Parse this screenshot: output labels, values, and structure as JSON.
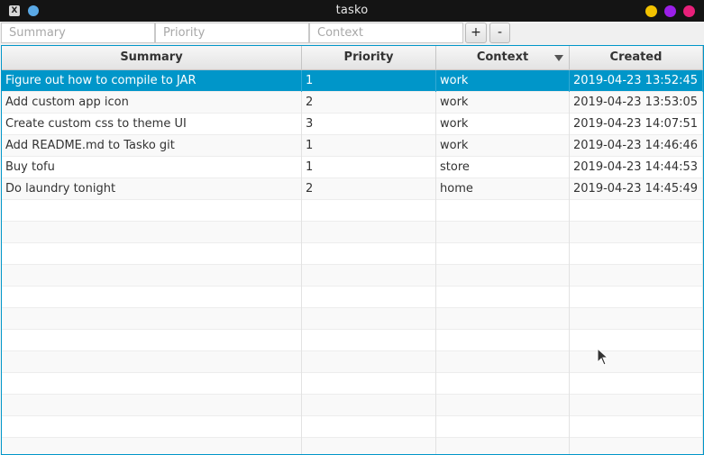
{
  "window": {
    "title": "tasko",
    "colors": {
      "minimize": "#f2c200",
      "maximize": "#9b1fe8",
      "close": "#e8207a"
    }
  },
  "toolbar": {
    "summary_placeholder": "Summary",
    "priority_placeholder": "Priority",
    "context_placeholder": "Context",
    "add_label": "+",
    "remove_label": "-"
  },
  "table": {
    "headers": {
      "summary": "Summary",
      "priority": "Priority",
      "context": "Context",
      "created": "Created"
    },
    "sorted_column": "context",
    "selection_color": "#0096c9",
    "rows": [
      {
        "summary": "Figure out how to compile to JAR",
        "priority": "1",
        "context": "work",
        "created": "2019-04-23 13:52:45",
        "selected": true
      },
      {
        "summary": "Add custom app icon",
        "priority": "2",
        "context": "work",
        "created": "2019-04-23 13:53:05"
      },
      {
        "summary": "Create custom css to theme UI",
        "priority": "3",
        "context": "work",
        "created": "2019-04-23 14:07:51"
      },
      {
        "summary": "Add README.md to Tasko git",
        "priority": "1",
        "context": "work",
        "created": "2019-04-23 14:46:46"
      },
      {
        "summary": "Buy tofu",
        "priority": "1",
        "context": "store",
        "created": "2019-04-23 14:44:53"
      },
      {
        "summary": "Do laundry tonight",
        "priority": "2",
        "context": "home",
        "created": "2019-04-23 14:45:49"
      }
    ],
    "visible_empty_rows": 12
  }
}
